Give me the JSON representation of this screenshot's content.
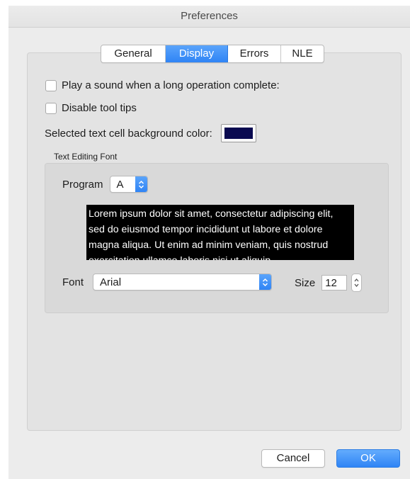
{
  "window": {
    "title": "Preferences"
  },
  "tabs": [
    {
      "label": "General",
      "active": false
    },
    {
      "label": "Display",
      "active": true
    },
    {
      "label": "Errors",
      "active": false
    },
    {
      "label": "NLE",
      "active": false
    }
  ],
  "options": {
    "play_sound": {
      "label": "Play a sound when a long operation complete:",
      "checked": false
    },
    "disable_tooltips": {
      "label": "Disable tool tips",
      "checked": false
    }
  },
  "background_color": {
    "label": "Selected text cell background color:",
    "value": "#0a0a50"
  },
  "text_editing_font": {
    "group_label": "Text Editing Font",
    "program_label": "Program",
    "program_value": "A",
    "preview_text": "Lorem ipsum dolor sit amet, consectetur adipiscing elit, sed do eiusmod tempor incididunt ut labore et dolore magna aliqua. Ut enim ad minim veniam, quis nostrud exercitation ullamco laboris nisi ut aliquip",
    "font_label": "Font",
    "font_value": "Arial",
    "size_label": "Size",
    "size_value": "12"
  },
  "buttons": {
    "cancel": "Cancel",
    "ok": "OK"
  },
  "colors": {
    "accent": "#2f84f5",
    "preview_background": "#000000",
    "preview_text": "#ffffff"
  },
  "icons": {
    "popup_arrows": "chevron-up-down-icon",
    "stepper": "stepper-arrows-icon"
  }
}
